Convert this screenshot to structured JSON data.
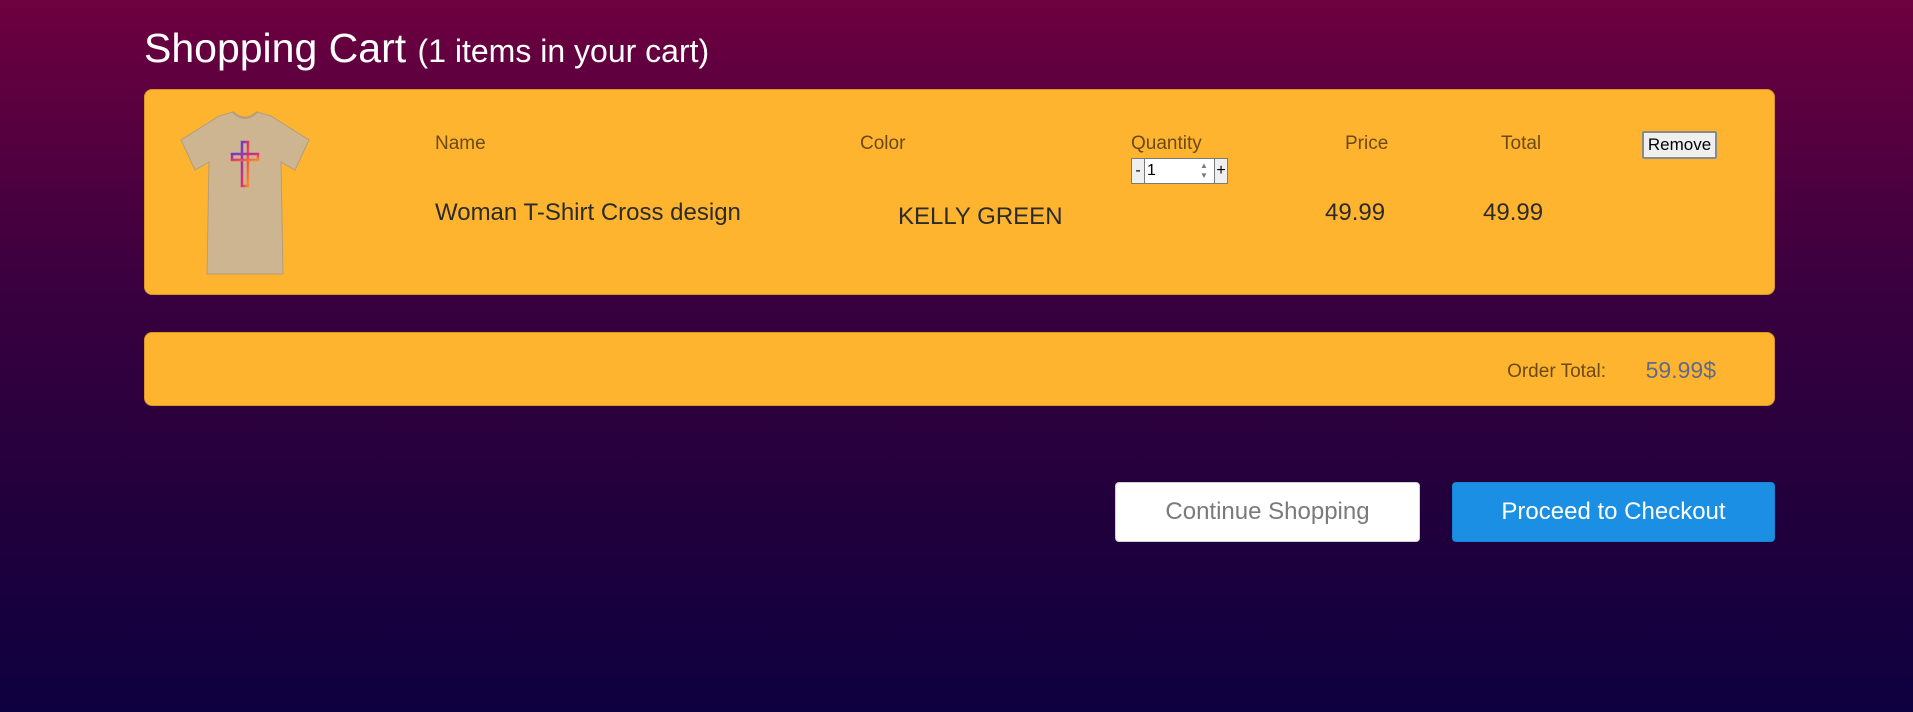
{
  "cart": {
    "title": "Shopping Cart",
    "item_count_text": "(1 items in your cart)"
  },
  "columns": {
    "name": "Name",
    "color": "Color",
    "quantity": "Quantity",
    "price": "Price",
    "total": "Total"
  },
  "items": [
    {
      "name": "Woman T-Shirt Cross design",
      "color": "KELLY GREEN",
      "quantity": "1",
      "price": "49.99",
      "total": "49.99",
      "image_icon": "tshirt-cross-image",
      "remove_label": "Remove",
      "decrement_label": "-",
      "increment_label": "+"
    }
  ],
  "summary": {
    "order_total_label": "Order Total:",
    "order_total_value": "59.99$"
  },
  "actions": {
    "continue_label": "Continue Shopping",
    "checkout_label": "Proceed to Checkout"
  },
  "colors": {
    "panel": "#ffb42f",
    "checkout_button": "#1a8fe3",
    "background_top": "#6e003f",
    "background_bottom": "#0e0040"
  }
}
